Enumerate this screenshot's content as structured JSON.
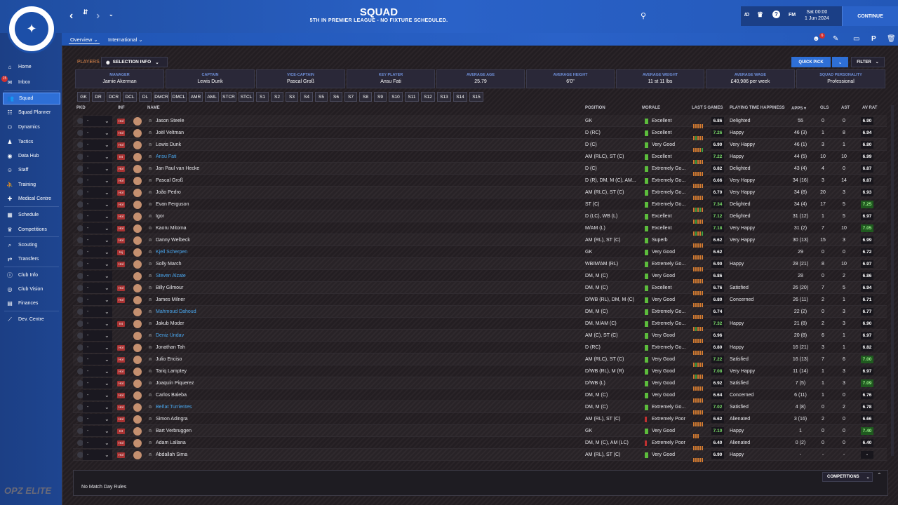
{
  "header": {
    "title": "SQUAD",
    "subtitle": "5TH IN PREMIER LEAGUE - NO FIXTURE SCHEDULED.",
    "date_line1": "Sat 00:00",
    "date_line2": "1 Jun 2024",
    "continue": "CONTINUE",
    "fm": "FM",
    "id": "ID",
    "notif": "6"
  },
  "club": {
    "badge_text": "BRIGHTON & HOVE ALBION"
  },
  "subtabs": {
    "overview": "Overview",
    "international": "International"
  },
  "sidebar": {
    "inbox_badge": "15",
    "items": [
      "Home",
      "Inbox",
      "Squad",
      "Squad Planner",
      "Dynamics",
      "Tactics",
      "Data Hub",
      "Staff",
      "Training",
      "Medical Centre",
      "Schedule",
      "Competitions",
      "Scouting",
      "Transfers",
      "Club Info",
      "Club Vision",
      "Finances",
      "Dev. Centre"
    ]
  },
  "toolbar": {
    "players": "PLAYERS",
    "selection_info": "SELECTION INFO",
    "quick_pick": "QUICK PICK",
    "filter": "FILTER"
  },
  "info": [
    {
      "label": "Manager",
      "value": "Jamie Akerman"
    },
    {
      "label": "Captain",
      "value": "Lewis Dunk"
    },
    {
      "label": "Vice-Captain",
      "value": "Pascal Groß"
    },
    {
      "label": "Key Player",
      "value": "Ansu Fati"
    },
    {
      "label": "Average Age",
      "value": "25.79"
    },
    {
      "label": "Average Height",
      "value": "6'0\""
    },
    {
      "label": "Average Weight",
      "value": "11 st 11 lbs"
    },
    {
      "label": "Average Wage",
      "value": "£40,986 per week"
    },
    {
      "label": "Squad Personality",
      "value": "Professional"
    }
  ],
  "positions": [
    "GK",
    "DR",
    "DCR",
    "DCL",
    "DL",
    "DMCR",
    "DMCL",
    "AMR",
    "AML",
    "STCR",
    "STCL",
    "S1",
    "S2",
    "S3",
    "S4",
    "S5",
    "S6",
    "S7",
    "S8",
    "S9",
    "S10",
    "S11",
    "S12",
    "S13",
    "S14",
    "S15"
  ],
  "columns": {
    "pkd": "PKD",
    "inf": "INF",
    "name": "NAME",
    "position": "POSITION",
    "morale": "MORALE",
    "last5": "LAST 5 GAMES",
    "pth": "PLAYING TIME HAPPINESS",
    "apps": "APPS",
    "gls": "GLS",
    "ast": "AST",
    "avrat": "AV RAT"
  },
  "players": [
    {
      "sel": "-",
      "inf": "Hol",
      "name": "Jason Steele",
      "pos": "GK",
      "morale": "Excellent",
      "rating": "6.86",
      "pth": "Delighted",
      "apps": "55",
      "gls": "0",
      "ast": "0",
      "avrat": "6.90"
    },
    {
      "sel": "-",
      "inf": "Hol",
      "name": "Joël Veltman",
      "pos": "D (RC)",
      "morale": "Excellent",
      "rating": "7.26",
      "pth": "Happy",
      "apps": "46 (3)",
      "gls": "1",
      "ast": "8",
      "avrat": "6.94"
    },
    {
      "sel": "-",
      "inf": "Hol",
      "name": "Lewis Dunk",
      "pos": "D (C)",
      "morale": "Very Good",
      "rating": "6.90",
      "pth": "Very Happy",
      "apps": "46 (1)",
      "gls": "3",
      "ast": "1",
      "avrat": "6.80"
    },
    {
      "sel": "-",
      "inf": "Int",
      "name": "Ansu Fati",
      "loan": true,
      "pos": "AM (RLC), ST (C)",
      "morale": "Excellent",
      "rating": "7.22",
      "pth": "Happy",
      "apps": "44 (5)",
      "gls": "10",
      "ast": "10",
      "avrat": "6.99"
    },
    {
      "sel": "-",
      "inf": "Hol",
      "name": "Jan Paul van Hecke",
      "pos": "D (C)",
      "morale": "Extremely Go...",
      "rating": "6.82",
      "pth": "Delighted",
      "apps": "43 (4)",
      "gls": "4",
      "ast": "0",
      "avrat": "6.87"
    },
    {
      "sel": "-",
      "inf": "Hol",
      "name": "Pascal Groß",
      "pos": "D (R), DM, M (C), AM...",
      "morale": "Extremely Go...",
      "rating": "6.66",
      "pth": "Very Happy",
      "apps": "34 (16)",
      "gls": "3",
      "ast": "14",
      "avrat": "6.87"
    },
    {
      "sel": "-",
      "inf": "Hol",
      "name": "João Pedro",
      "pos": "AM (RLC), ST (C)",
      "morale": "Extremely Go...",
      "rating": "6.70",
      "pth": "Very Happy",
      "apps": "34 (8)",
      "gls": "20",
      "ast": "3",
      "avrat": "6.93"
    },
    {
      "sel": "-",
      "inf": "Hol",
      "name": "Evan Ferguson",
      "pos": "ST (C)",
      "morale": "Extremely Go...",
      "rating": "7.34",
      "pth": "Delighted",
      "apps": "34 (4)",
      "gls": "17",
      "ast": "5",
      "avrat": "7.25"
    },
    {
      "sel": "-",
      "inf": "Hol",
      "name": "Igor",
      "pos": "D (LC), WB (L)",
      "morale": "Excellent",
      "rating": "7.12",
      "pth": "Delighted",
      "apps": "31 (12)",
      "gls": "1",
      "ast": "5",
      "avrat": "6.97"
    },
    {
      "sel": "-",
      "inf": "Hol",
      "name": "Kaoru Mitoma",
      "pos": "M/AM (L)",
      "morale": "Excellent",
      "rating": "7.18",
      "pth": "Very Happy",
      "apps": "31 (2)",
      "gls": "7",
      "ast": "10",
      "avrat": "7.05"
    },
    {
      "sel": "-",
      "inf": "Hol",
      "name": "Danny Welbeck",
      "pos": "AM (RL), ST (C)",
      "morale": "Superb",
      "rating": "6.62",
      "pth": "Very Happy",
      "apps": "30 (13)",
      "gls": "15",
      "ast": "3",
      "avrat": "6.99"
    },
    {
      "sel": "-",
      "inf": "Inj",
      "name": "Kjell Scherpen",
      "loan": true,
      "pos": "GK",
      "morale": "Very Good",
      "rating": "6.62",
      "pth": "",
      "apps": "29",
      "gls": "0",
      "ast": "0",
      "avrat": "6.72"
    },
    {
      "sel": "-",
      "inf": "Hol",
      "name": "Solly March",
      "pos": "WB/M/AM (RL)",
      "morale": "Extremely Go...",
      "rating": "6.90",
      "pth": "Happy",
      "apps": "28 (21)",
      "gls": "8",
      "ast": "10",
      "avrat": "6.97"
    },
    {
      "sel": "-",
      "inf": "",
      "name": "Steven Alzate",
      "loan": true,
      "pos": "DM, M (C)",
      "morale": "Very Good",
      "rating": "6.86",
      "pth": "",
      "apps": "28",
      "gls": "0",
      "ast": "2",
      "avrat": "6.86"
    },
    {
      "sel": "-",
      "inf": "Hol",
      "name": "Billy Gilmour",
      "pos": "DM, M (C)",
      "morale": "Excellent",
      "rating": "6.76",
      "pth": "Satisfied",
      "apps": "26 (20)",
      "gls": "7",
      "ast": "5",
      "avrat": "6.94"
    },
    {
      "sel": "-",
      "inf": "Hol",
      "name": "James Milner",
      "pos": "D/WB (RL), DM, M (C)",
      "morale": "Very Good",
      "rating": "6.80",
      "pth": "Concerned",
      "apps": "26 (11)",
      "gls": "2",
      "ast": "1",
      "avrat": "6.71"
    },
    {
      "sel": "-",
      "inf": "",
      "name": "Mahmoud Dahoud",
      "loan": true,
      "pos": "DM, M (C)",
      "morale": "Extremely Go...",
      "rating": "6.74",
      "pth": "",
      "apps": "22 (2)",
      "gls": "0",
      "ast": "3",
      "avrat": "6.77"
    },
    {
      "sel": "-",
      "inf": "Int",
      "name": "Jakub Moder",
      "pos": "DM, M/AM (C)",
      "morale": "Extremely Go...",
      "rating": "7.32",
      "pth": "Happy",
      "apps": "21 (8)",
      "gls": "2",
      "ast": "3",
      "avrat": "6.90"
    },
    {
      "sel": "-",
      "inf": "",
      "name": "Deniz Undav",
      "loan": true,
      "pos": "AM (C), ST (C)",
      "morale": "Very Good",
      "rating": "6.96",
      "pth": "",
      "apps": "20 (8)",
      "gls": "6",
      "ast": "1",
      "avrat": "6.97"
    },
    {
      "sel": "-",
      "inf": "Hol",
      "name": "Jonathan Tah",
      "pos": "D (RC)",
      "morale": "Extremely Go...",
      "rating": "6.80",
      "pth": "Happy",
      "apps": "16 (21)",
      "gls": "3",
      "ast": "1",
      "avrat": "6.82"
    },
    {
      "sel": "-",
      "inf": "Hol",
      "name": "Julio Enciso",
      "pos": "AM (RLC), ST (C)",
      "morale": "Very Good",
      "rating": "7.22",
      "pth": "Satisfied",
      "apps": "16 (13)",
      "gls": "7",
      "ast": "6",
      "avrat": "7.00"
    },
    {
      "sel": "-",
      "inf": "Hol",
      "name": "Tariq Lamptey",
      "pos": "D/WB (RL), M (R)",
      "morale": "Very Good",
      "rating": "7.08",
      "pth": "Very Happy",
      "apps": "11 (14)",
      "gls": "1",
      "ast": "3",
      "avrat": "6.97"
    },
    {
      "sel": "-",
      "inf": "Hol",
      "name": "Joaquín Piquerez",
      "pos": "D/WB (L)",
      "morale": "Very Good",
      "rating": "6.92",
      "pth": "Satisfied",
      "apps": "7 (5)",
      "gls": "1",
      "ast": "3",
      "avrat": "7.09"
    },
    {
      "sel": "-",
      "inf": "Hol",
      "name": "Carlos Baleba",
      "pos": "DM, M (C)",
      "morale": "Very Good",
      "rating": "6.64",
      "pth": "Concerned",
      "apps": "6 (11)",
      "gls": "1",
      "ast": "0",
      "avrat": "6.76"
    },
    {
      "sel": "-",
      "inf": "Hol",
      "name": "Beñat Turrientes",
      "loan": true,
      "pos": "DM, M (C)",
      "morale": "Extremely Go...",
      "rating": "7.02",
      "pth": "Satisfied",
      "apps": "4 (8)",
      "gls": "0",
      "ast": "2",
      "avrat": "6.78"
    },
    {
      "sel": "-",
      "inf": "Hol",
      "name": "Simon Adingra",
      "pos": "AM (RL), ST (C)",
      "morale": "Extremely Poor",
      "rating": "6.62",
      "pth": "Alienated",
      "apps": "3 (16)",
      "gls": "2",
      "ast": "0",
      "avrat": "6.66"
    },
    {
      "sel": "-",
      "inf": "Int",
      "name": "Bart Verbruggen",
      "pos": "GK",
      "morale": "Very Good",
      "rating": "7.10",
      "pth": "Happy",
      "apps": "1",
      "gls": "0",
      "ast": "0",
      "avrat": "7.40"
    },
    {
      "sel": "-",
      "inf": "Hol",
      "name": "Adam Lallana",
      "pos": "DM, M (C), AM (LC)",
      "morale": "Extremely Poor",
      "rating": "6.40",
      "pth": "Alienated",
      "apps": "0 (2)",
      "gls": "0",
      "ast": "0",
      "avrat": "6.40"
    },
    {
      "sel": "-",
      "inf": "Hol",
      "name": "Abdallah Sima",
      "pos": "AM (RL), ST (C)",
      "morale": "Very Good",
      "rating": "6.90",
      "pth": "Happy",
      "apps": "-",
      "gls": "-",
      "ast": "-",
      "avrat": "-"
    }
  ],
  "footer": {
    "text": "No Match Day Rules",
    "competitions": "COMPETITIONS"
  },
  "branding": {
    "opz": "OPZ ELITE"
  }
}
